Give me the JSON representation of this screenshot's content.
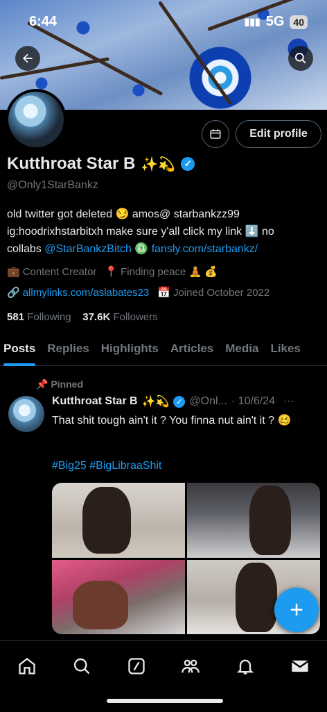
{
  "status_bar": {
    "time": "6:44",
    "network": "5G",
    "battery": "40"
  },
  "header": {
    "back_icon": "arrow-left-icon",
    "search_icon": "search-icon"
  },
  "profile": {
    "name": "Kutthroat Star B",
    "name_emojis": "✨💫",
    "handle": "@Only1StarBankz",
    "edit_profile_label": "Edit profile",
    "bio_line1": "old twitter got deleted 😏 amos@ starbankzz99",
    "bio_line2": "ig:hoodrixhstarbitxh make sure y'all click my link ⬇️ no",
    "bio_line3_pre": "collabs ",
    "bio_mention": "@StarBankzBitch",
    "bio_sign": " ♎ ",
    "bio_link": "fansly.com/starbankz/",
    "category": "Content Creator",
    "location": "Finding peace 🧘 💰",
    "website": "allmylinks.com/aslabates23",
    "joined": "Joined October 2022",
    "following_count": "581",
    "following_label": "Following",
    "followers_count": "37.6K",
    "followers_label": "Followers"
  },
  "tabs": [
    {
      "label": "Posts",
      "active": true
    },
    {
      "label": "Replies"
    },
    {
      "label": "Highlights"
    },
    {
      "label": "Articles"
    },
    {
      "label": "Media"
    },
    {
      "label": "Likes"
    }
  ],
  "post": {
    "pinned_label": "Pinned",
    "author": "Kutthroat Star B",
    "author_emojis": "✨💫",
    "handle": "@Onl...",
    "date": "· 10/6/24",
    "more": "···",
    "text": "That shit tough ain't it ? You finna nut ain't it ? 🥴",
    "hashtags": "#Big25 #BigLibraaShit"
  },
  "bottom_nav": [
    "home-icon",
    "search-icon",
    "grok-icon",
    "communities-icon",
    "notifications-icon",
    "messages-icon"
  ],
  "colors": {
    "accent": "#1d9bf0",
    "background": "#000000",
    "muted": "#71767b",
    "text": "#e7e9ea"
  }
}
